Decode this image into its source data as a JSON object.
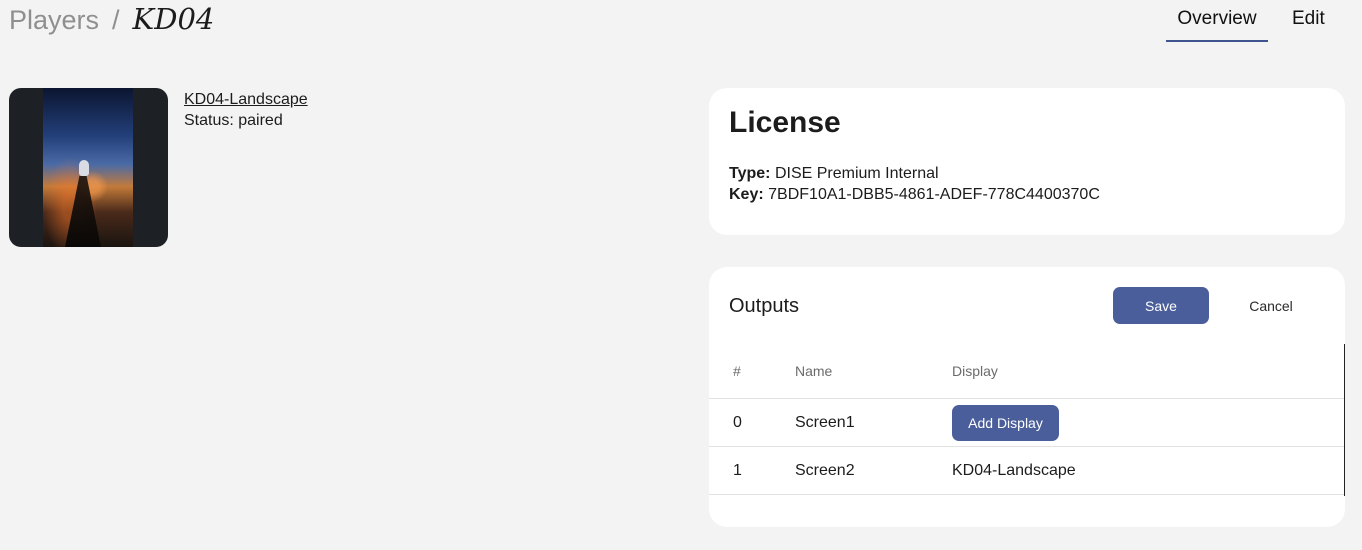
{
  "breadcrumb": {
    "root": "Players",
    "separator": "/",
    "current": "KD04"
  },
  "tabs": [
    {
      "label": "Overview",
      "active": true
    },
    {
      "label": "Edit",
      "active": false
    }
  ],
  "player": {
    "name": "KD04-Landscape",
    "status": "Status: paired"
  },
  "license": {
    "title": "License",
    "type_label": "Type:",
    "type_value": "DISE Premium Internal",
    "key_label": "Key:",
    "key_value": "7BDF10A1-DBB5-4861-ADEF-778C4400370C"
  },
  "outputs": {
    "title": "Outputs",
    "save_label": "Save",
    "cancel_label": "Cancel",
    "columns": [
      "#",
      "Name",
      "Display"
    ],
    "rows": [
      {
        "num": "0",
        "name": "Screen1",
        "display": null,
        "action_label": "Add Display"
      },
      {
        "num": "1",
        "name": "Screen2",
        "display": "KD04-Landscape"
      }
    ]
  },
  "colors": {
    "accent": "#4a5e9b",
    "background": "#f3f3f3",
    "card": "#ffffff"
  }
}
